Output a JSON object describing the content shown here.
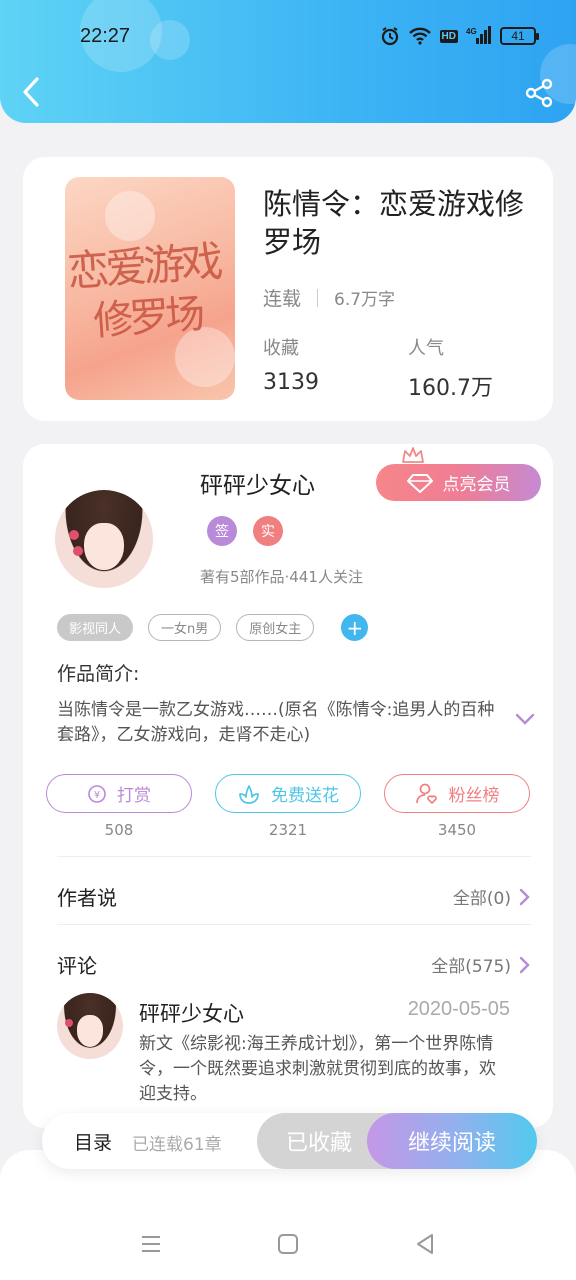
{
  "status_bar": {
    "time": "22:27",
    "network_badge": "HD",
    "signal_label": "4G",
    "battery": "41"
  },
  "book": {
    "title": "陈情令：恋爱游戏修罗场",
    "status": "连载",
    "word_count": "6.7万字",
    "cover_title_line1": "恋爱游戏",
    "cover_title_line2": "修罗场",
    "stats": [
      {
        "label": "收藏",
        "value": "3139"
      },
      {
        "label": "人气",
        "value": "160.7万"
      }
    ]
  },
  "author": {
    "name": "砰砰少女心",
    "vip_button": "点亮会员",
    "badges": [
      "签",
      "实"
    ],
    "info": "著有5部作品·441人关注",
    "tags": [
      "影视同人",
      "一女n男",
      "原创女主"
    ],
    "tag_add": "+"
  },
  "intro": {
    "title": "作品简介:",
    "text": "当陈情令是一款乙女游戏……(原名《陈情令:追男人的百种套路》，乙女游戏向，走肾不走心)"
  },
  "actions": [
    {
      "label": "打赏",
      "count": "508",
      "color": "#b98ad8"
    },
    {
      "label": "免费送花",
      "count": "2321",
      "color": "#4fc6e8"
    },
    {
      "label": "粉丝榜",
      "count": "3450",
      "color": "#f08080"
    }
  ],
  "author_says": {
    "title": "作者说",
    "more": "全部(0)"
  },
  "comments": {
    "title": "评论",
    "more": "全部(575)",
    "items": [
      {
        "user": "砰砰少女心",
        "date": "2020-05-05",
        "text": "新文《综影视:海王养成计划》，第一个世界陈情令，一个既然要追求刺激就贯彻到底的故事，欢迎支持。"
      }
    ]
  },
  "bottom_bar": {
    "toc": "目录",
    "chapter_count": "已连载61章",
    "collected": "已收藏",
    "read": "继续阅读"
  },
  "colors": {
    "header_start": "#5fd3f5",
    "header_end": "#2ea3f2",
    "accent_purple": "#b98ad8",
    "accent_blue": "#41b7ee"
  }
}
